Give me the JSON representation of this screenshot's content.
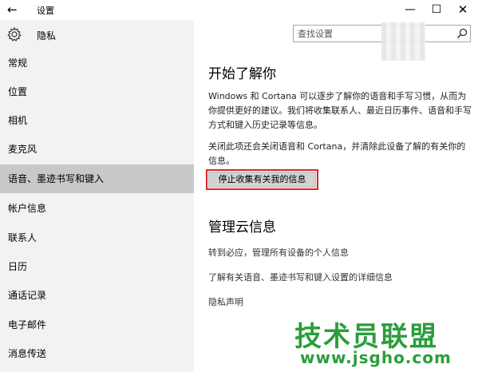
{
  "window": {
    "title": "设置",
    "back_glyph": "←",
    "minimize_glyph": "—",
    "maximize_glyph": "☐",
    "close_glyph": "✕"
  },
  "header": {
    "title": "隐私",
    "icon": "gear-icon"
  },
  "search": {
    "placeholder": "查找设置",
    "value": "",
    "icon": "search-icon"
  },
  "sidebar": {
    "items": [
      {
        "label": "常规",
        "selected": false
      },
      {
        "label": "位置",
        "selected": false
      },
      {
        "label": "相机",
        "selected": false
      },
      {
        "label": "麦克风",
        "selected": false
      },
      {
        "label": "语音、墨迹书写和键入",
        "selected": true
      },
      {
        "label": "帐户信息",
        "selected": false
      },
      {
        "label": "联系人",
        "selected": false
      },
      {
        "label": "日历",
        "selected": false
      },
      {
        "label": "通话记录",
        "selected": false
      },
      {
        "label": "电子邮件",
        "selected": false
      },
      {
        "label": "消息传送",
        "selected": false
      }
    ]
  },
  "main": {
    "section1": {
      "title": "开始了解你",
      "paragraph1": "Windows 和 Cortana 可以逐步了解你的语音和手写习惯，从而为你提供更好的建议。我们将收集联系人、最近日历事件、语音和手写方式和键入历史记录等信息。",
      "paragraph2": "关闭此项还会关闭语音和 Cortana，并清除此设备了解的有关你的信息。",
      "button_label": "停止收集有关我的信息"
    },
    "section2": {
      "title": "管理云信息",
      "links": [
        "转到必应，管理所有设备的个人信息",
        "了解有关语音、墨迹书写和键入设置的详细信息",
        "隐私声明"
      ]
    }
  },
  "watermark": {
    "brand": "技术员联盟",
    "url": "www.jsgho.com"
  },
  "colors": {
    "sidebar_bg": "#f2f2f2",
    "selected_bg": "#c8c8c8",
    "highlight_border": "#d7262a",
    "watermark": "#2a9e3c"
  }
}
